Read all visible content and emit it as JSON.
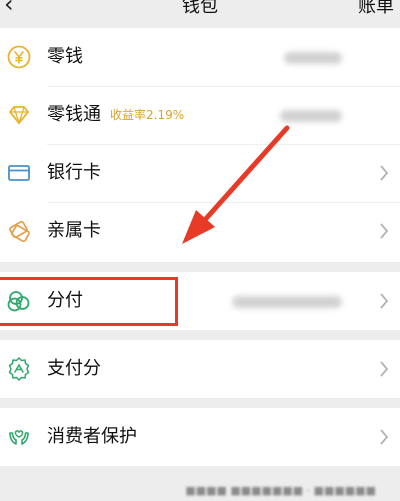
{
  "header": {
    "back_icon": "chevron-left-icon",
    "title": "钱包",
    "bill_label": "账单"
  },
  "items": [
    {
      "label": "零钱",
      "icon": "yuan-coin-icon",
      "value_blurred": true
    },
    {
      "label": "零钱通",
      "badge": "收益率2.19%",
      "icon": "diamond-icon",
      "value_blurred": true
    },
    {
      "label": "银行卡",
      "icon": "bank-card-icon",
      "has_chevron": true
    },
    {
      "label": "亲属卡",
      "icon": "family-card-icon",
      "has_chevron": true
    },
    {
      "label": "分付",
      "icon": "fenfu-icon",
      "value_blurred": true,
      "has_chevron": true,
      "highlighted": true
    },
    {
      "label": "支付分",
      "icon": "pay-score-icon",
      "has_chevron": true
    },
    {
      "label": "消费者保护",
      "icon": "consumer-protection-icon",
      "has_chevron": true
    }
  ],
  "annotation": {
    "arrow_color": "#e73b27",
    "box_color": "#e73b27"
  },
  "colors": {
    "icon_yellow": "#e8b42b",
    "icon_blue": "#4a90c8",
    "icon_orange": "#e3a04a",
    "icon_green": "#2fa86d",
    "badge": "#d9a425"
  }
}
